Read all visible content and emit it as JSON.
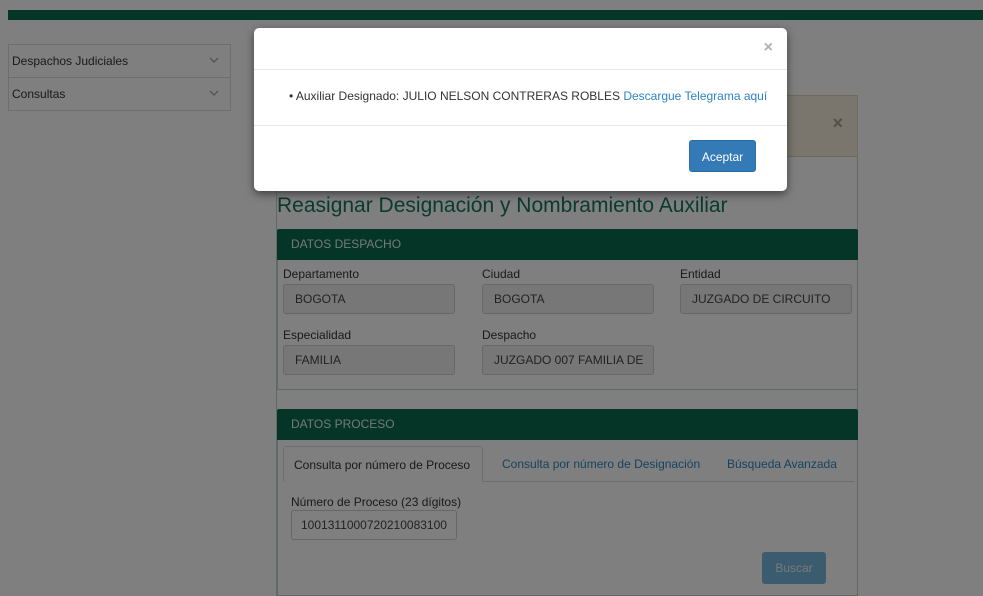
{
  "sidebar": {
    "items": [
      {
        "label": "Despachos Judiciales"
      },
      {
        "label": "Consultas"
      }
    ]
  },
  "alert": {
    "close_glyph": "×"
  },
  "page": {
    "title": "Reasignar Designación y Nombramiento Auxiliar"
  },
  "datos_despacho": {
    "header": "DATOS DESPACHO",
    "fields": {
      "departamento": {
        "label": "Departamento",
        "value": "BOGOTA"
      },
      "ciudad": {
        "label": "Ciudad",
        "value": "BOGOTA"
      },
      "entidad": {
        "label": "Entidad",
        "value": "JUZGADO DE CIRCUITO"
      },
      "especialidad": {
        "label": "Especialidad",
        "value": "FAMILIA"
      },
      "despacho": {
        "label": "Despacho",
        "value": "JUZGADO 007  FAMILIA DE"
      }
    }
  },
  "datos_proceso": {
    "header": "DATOS PROCESO",
    "tabs": [
      {
        "label": "Consulta por número de Proceso",
        "active": true
      },
      {
        "label": "Consulta por número de Designación",
        "active": false
      },
      {
        "label": "Búsqueda Avanzada",
        "active": false
      }
    ],
    "numero_proceso": {
      "label": "Número de Proceso (23 dígitos)",
      "value": "10013110007202100831​00"
    },
    "search_label": "Buscar"
  },
  "modal": {
    "close_glyph": "×",
    "bullet": "•",
    "message": "Auxiliar Designado: JULIO NELSON CONTRERAS ROBLES",
    "link": "Descargue Telegrama aquí",
    "accept_label": "Aceptar"
  },
  "colors": {
    "brand_green": "#0a6a4d",
    "title_green": "#13775c",
    "primary_blue": "#337ab7",
    "link_blue": "#2f84c3",
    "alert_bg": "#f4eddc"
  },
  "icons": {
    "chevron": "chevron-down-icon",
    "close": "close-icon"
  }
}
